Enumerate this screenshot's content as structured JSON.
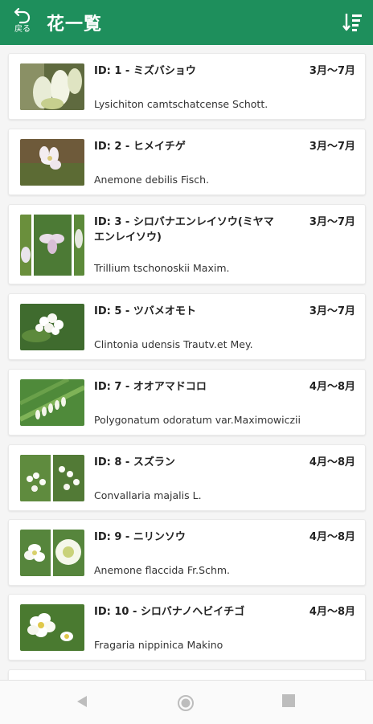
{
  "app": {
    "back_label": "戻る",
    "title": "花一覧",
    "colors": {
      "primary": "#1e8f5c",
      "card": "#ffffff",
      "background": "#f5f5f5"
    },
    "icons": {
      "back": "undo-arrow-icon",
      "sort": "sort-descending-icon"
    }
  },
  "flowers": [
    {
      "title": "ID: 1 - ミズバショウ",
      "season": "3月〜7月",
      "scientific": "Lysichiton camtschatcense Schott.",
      "thumb": "skunk-cabbage-photo"
    },
    {
      "title": "ID: 2 - ヒメイチゲ",
      "season": "3月〜7月",
      "scientific": "Anemone debilis  Fisch.",
      "thumb": "anemone-photo"
    },
    {
      "title": "ID: 3 - シロバナエンレイソウ(ミヤマエンレイソウ)",
      "season": "3月〜7月",
      "scientific": "Trillium tschonoskii Maxim.",
      "thumb": "trillium-photo"
    },
    {
      "title": "ID: 5 - ツバメオモト",
      "season": "3月〜7月",
      "scientific": "Clintonia udensis Trautv.et Mey.",
      "thumb": "clintonia-photo"
    },
    {
      "title": "ID: 7 - オオアマドコロ",
      "season": "4月〜8月",
      "scientific": "Polygonatum odoratum var.Maximowiczii",
      "thumb": "polygonatum-photo"
    },
    {
      "title": "ID: 8 - スズラン",
      "season": "4月〜8月",
      "scientific": "Convallaria majalis L.",
      "thumb": "lily-of-the-valley-photo"
    },
    {
      "title": "ID: 9 - ニリンソウ",
      "season": "4月〜8月",
      "scientific": "Anemone flaccida Fr.Schm.",
      "thumb": "nirinsou-photo"
    },
    {
      "title": "ID: 10 - シロバナノヘビイチゴ",
      "season": "4月〜8月",
      "scientific": "Fragaria nippinica Makino",
      "thumb": "wild-strawberry-photo"
    }
  ],
  "navigation": {
    "back": "nav-back-icon",
    "home": "nav-home-icon",
    "recents": "nav-recents-icon"
  }
}
